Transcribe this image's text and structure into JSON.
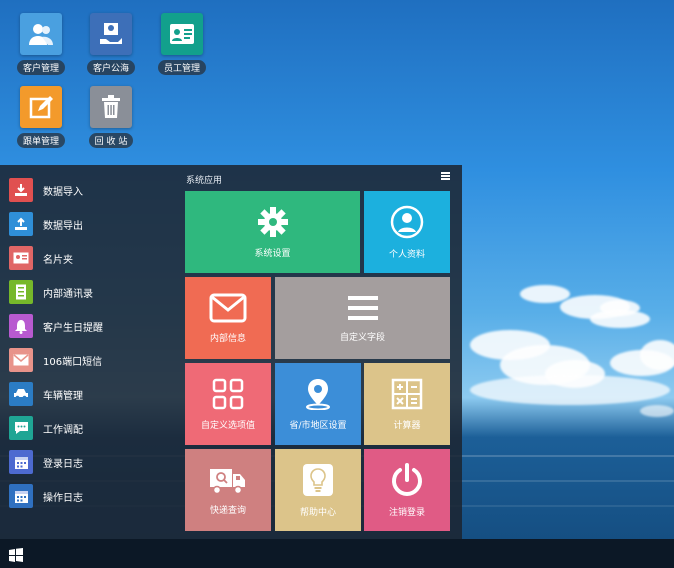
{
  "desktop": {
    "icons": [
      {
        "label": "客户管理",
        "icon": "users-icon",
        "color": "#4aa0e0"
      },
      {
        "label": "客户公海",
        "icon": "share-contact-icon",
        "color": "#3d6fb8"
      },
      {
        "label": "员工管理",
        "icon": "id-card-icon",
        "color": "#12a08c"
      },
      {
        "label": "跟单管理",
        "icon": "edit-icon",
        "color": "#f39a2b"
      },
      {
        "label": "回 收 站",
        "icon": "trash-icon",
        "color": "#8a8f98"
      }
    ]
  },
  "start_menu": {
    "list": [
      {
        "label": "数据导入",
        "icon": "download-icon",
        "color": "#e05050"
      },
      {
        "label": "数据导出",
        "icon": "upload-icon",
        "color": "#2f8fd8"
      },
      {
        "label": "名片夹",
        "icon": "card-icon",
        "color": "#e06666"
      },
      {
        "label": "内部通讯录",
        "icon": "address-book-icon",
        "color": "#76b82a"
      },
      {
        "label": "客户生日提醒",
        "icon": "bell-icon",
        "color": "#b85ad0"
      },
      {
        "label": "106端口短信",
        "icon": "mail-icon",
        "color": "#e8938a"
      },
      {
        "label": "车辆管理",
        "icon": "car-icon",
        "color": "#2b7cc4"
      },
      {
        "label": "工作调配",
        "icon": "chat-icon",
        "color": "#1fa594"
      },
      {
        "label": "登录日志",
        "icon": "calendar-icon",
        "color": "#4d6ad0"
      },
      {
        "label": "操作日志",
        "icon": "calendar-icon",
        "color": "#2f70c0"
      }
    ],
    "apps_title": "系统应用",
    "tiles": [
      {
        "label": "系统设置",
        "icon": "gear-icon",
        "color": "#2fb87e"
      },
      {
        "label": "个人资料",
        "icon": "profile-icon",
        "color": "#1cb0de"
      },
      {
        "label": "内部信息",
        "icon": "envelope-icon",
        "color": "#f06b53"
      },
      {
        "label": "自定义字段",
        "icon": "list-icon",
        "color": "#a49e9e"
      },
      {
        "label": "自定义选项值",
        "icon": "grid-icon",
        "color": "#ef6a76"
      },
      {
        "label": "省/市地区设置",
        "icon": "location-icon",
        "color": "#3c8ed8"
      },
      {
        "label": "计算器",
        "icon": "calculator-icon",
        "color": "#dcc48a"
      },
      {
        "label": "快递查询",
        "icon": "truck-icon",
        "color": "#cf8080"
      },
      {
        "label": "帮助中心",
        "icon": "bulb-icon",
        "color": "#dcc48a"
      },
      {
        "label": "注销登录",
        "icon": "power-icon",
        "color": "#e05b85"
      }
    ]
  },
  "taskbar": {
    "start_icon": "windows-icon"
  }
}
